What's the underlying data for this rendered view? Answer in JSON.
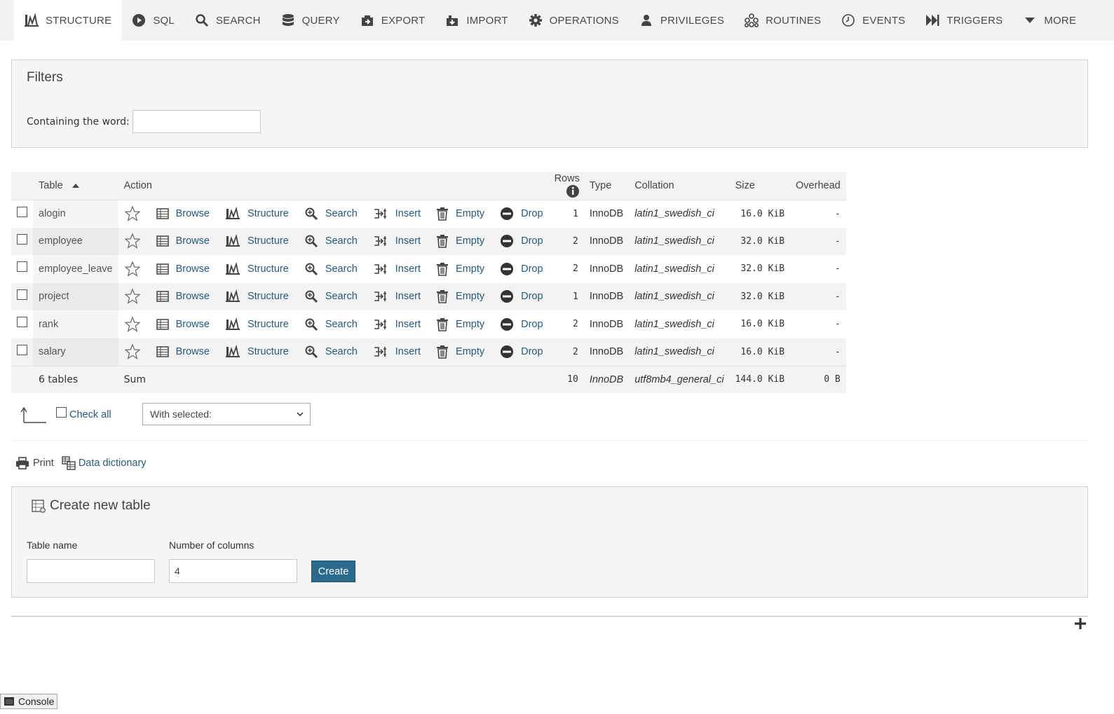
{
  "tabs": [
    {
      "label": "STRUCTURE",
      "icon": "structure-icon",
      "active": true
    },
    {
      "label": "SQL",
      "icon": "sql-icon"
    },
    {
      "label": "SEARCH",
      "icon": "search-icon"
    },
    {
      "label": "QUERY",
      "icon": "query-icon"
    },
    {
      "label": "EXPORT",
      "icon": "export-icon"
    },
    {
      "label": "IMPORT",
      "icon": "import-icon"
    },
    {
      "label": "OPERATIONS",
      "icon": "gear-icon"
    },
    {
      "label": "PRIVILEGES",
      "icon": "user-icon"
    },
    {
      "label": "ROUTINES",
      "icon": "routines-icon"
    },
    {
      "label": "EVENTS",
      "icon": "clock-icon"
    },
    {
      "label": "TRIGGERS",
      "icon": "triggers-icon"
    },
    {
      "label": "MORE",
      "icon": "caret-down-icon"
    }
  ],
  "filters": {
    "legend": "Filters",
    "label": "Containing the word:",
    "value": ""
  },
  "table": {
    "headers": {
      "table": "Table",
      "action": "Action",
      "rows": "Rows",
      "type": "Type",
      "collation": "Collation",
      "size": "Size",
      "overhead": "Overhead"
    },
    "actions": [
      "Browse",
      "Structure",
      "Search",
      "Insert",
      "Empty",
      "Drop"
    ],
    "rows": [
      {
        "name": "alogin",
        "rows": "1",
        "type": "InnoDB",
        "collation": "latin1_swedish_ci",
        "size": "16.0 KiB",
        "overhead": "-"
      },
      {
        "name": "employee",
        "rows": "2",
        "type": "InnoDB",
        "collation": "latin1_swedish_ci",
        "size": "32.0 KiB",
        "overhead": "-"
      },
      {
        "name": "employee_leave",
        "rows": "2",
        "type": "InnoDB",
        "collation": "latin1_swedish_ci",
        "size": "32.0 KiB",
        "overhead": "-"
      },
      {
        "name": "project",
        "rows": "1",
        "type": "InnoDB",
        "collation": "latin1_swedish_ci",
        "size": "32.0 KiB",
        "overhead": "-"
      },
      {
        "name": "rank",
        "rows": "2",
        "type": "InnoDB",
        "collation": "latin1_swedish_ci",
        "size": "16.0 KiB",
        "overhead": "-"
      },
      {
        "name": "salary",
        "rows": "2",
        "type": "InnoDB",
        "collation": "latin1_swedish_ci",
        "size": "16.0 KiB",
        "overhead": "-"
      }
    ],
    "footer": {
      "count": "6 tables",
      "sum": "Sum",
      "rows": "10",
      "type": "InnoDB",
      "collation": "utf8mb4_general_ci",
      "size": "144.0 KiB",
      "overhead": "0 B"
    }
  },
  "bulk": {
    "check_all": "Check all",
    "with_selected": "With selected:"
  },
  "links": {
    "print": "Print",
    "data_dictionary": "Data dictionary"
  },
  "create_table": {
    "legend": "Create new table",
    "name_label": "Table name",
    "name_value": "",
    "columns_label": "Number of columns",
    "columns_value": "4",
    "button": "Create"
  },
  "console": {
    "label": "Console"
  },
  "colors": {
    "link": "#235a81",
    "button": "#2b6a8c",
    "panel": "#f5f5f5",
    "topbar": "#f2f2f2"
  }
}
